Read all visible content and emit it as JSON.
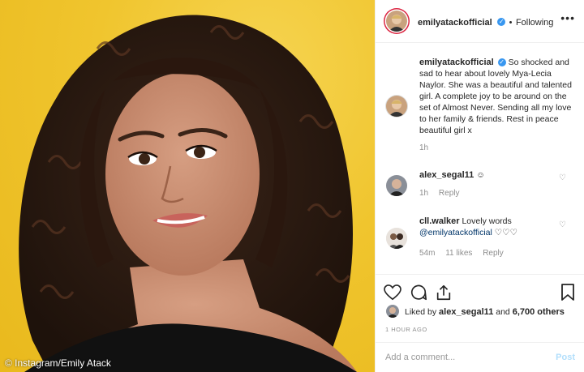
{
  "photo": {
    "credit": "© Instagram/Emily Atack"
  },
  "header": {
    "username": "emilyatackofficial",
    "verified_badge": "✓",
    "separator": "•",
    "follow_status": "Following",
    "more_icon": "•••"
  },
  "caption": {
    "username": "emilyatackofficial",
    "text": "So shocked and sad to hear about lovely Mya-Lecia Naylor. She was a beautiful and talented girl. A complete joy to be around on the set of Almost Never. Sending all my love to her family & friends. Rest in peace beautiful girl x",
    "time": "1h"
  },
  "comments": [
    {
      "username": "alex_segal11",
      "text": "☺",
      "time": "1h",
      "reply": "Reply"
    },
    {
      "username": "cll.walker",
      "text": "Lovely words",
      "mention": "@emilyatackofficial",
      "hearts": "♡♡♡",
      "time": "54m",
      "likes": "11 likes",
      "reply": "Reply"
    }
  ],
  "likes": {
    "liked_by": "Liked by",
    "user": "alex_segal11",
    "and": "and",
    "count": "6,700 others"
  },
  "timestamp": "1 HOUR AGO",
  "comment_box": {
    "placeholder": "Add a comment...",
    "post": "Post"
  },
  "colors": {
    "background_yellow": "#f0c52e",
    "verified_blue": "#3897f0",
    "link": "#003569"
  }
}
